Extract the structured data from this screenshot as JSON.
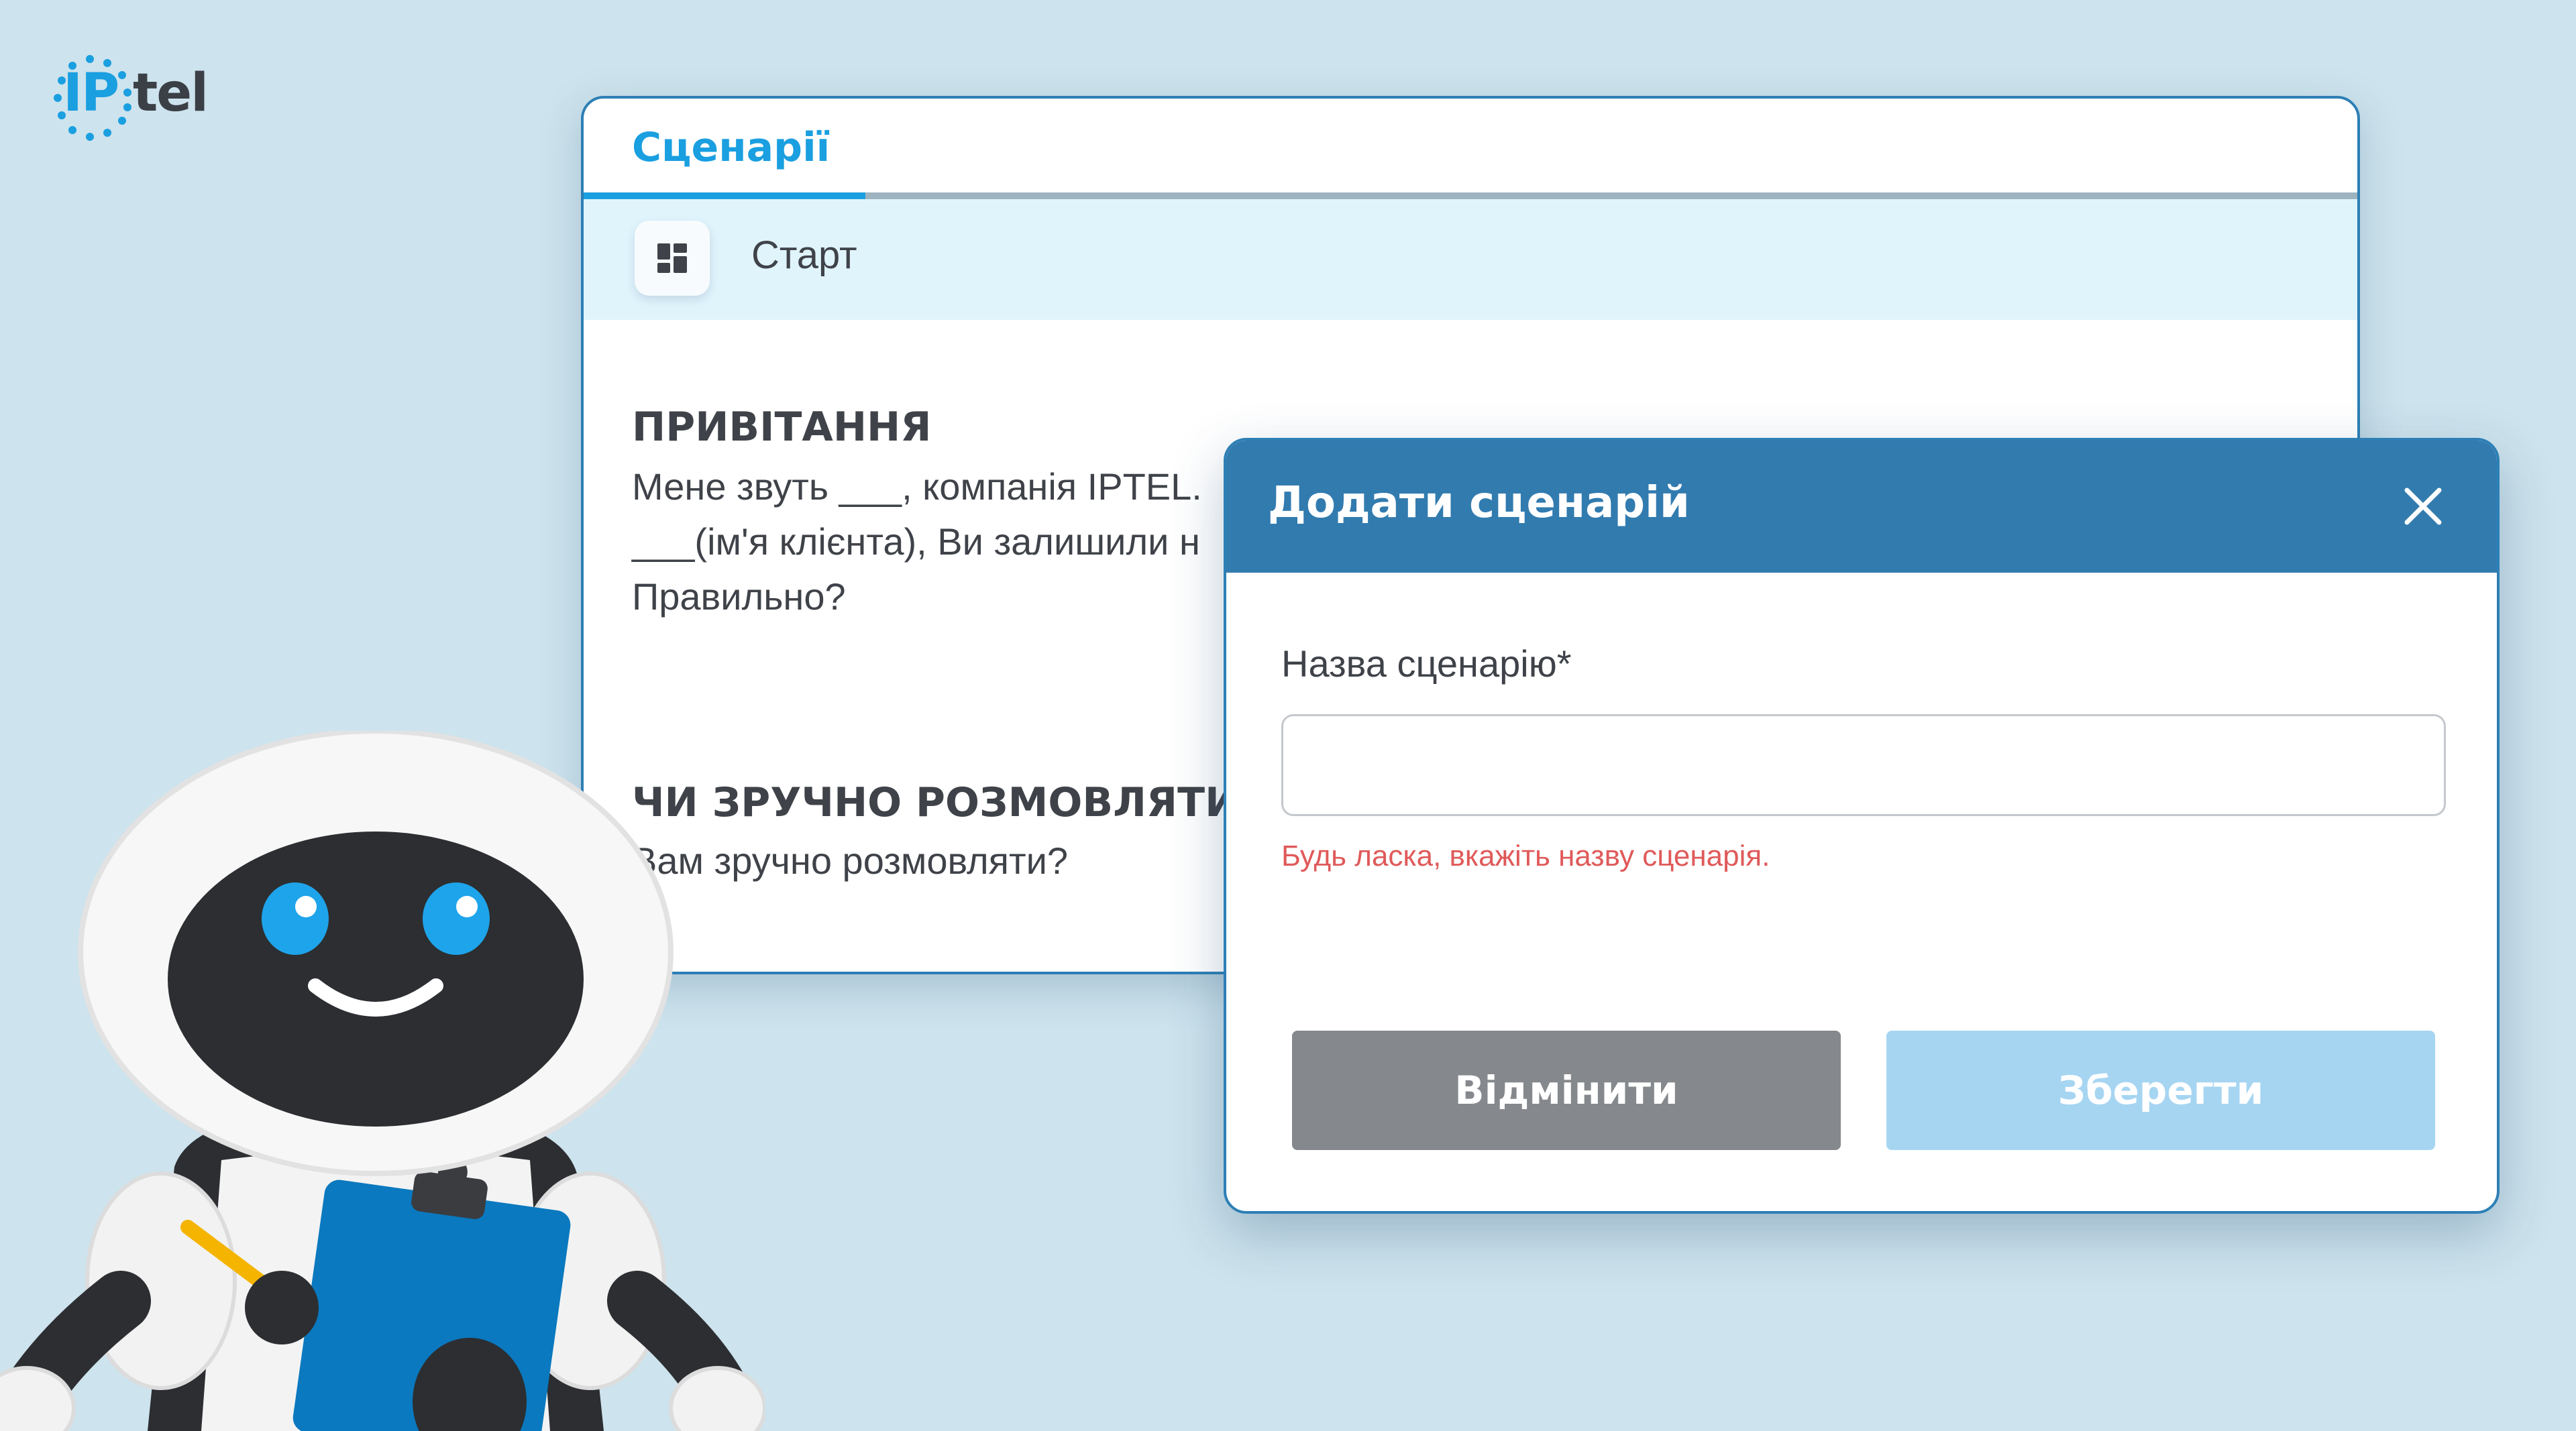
{
  "logo": {
    "ip": "IP",
    "tel": "tel",
    "brand_color": "#1a9fe0"
  },
  "card": {
    "tab_label": "Сценарії",
    "toolbar": {
      "icon": "dashboard-grid-icon",
      "label": "Старт"
    },
    "sections": [
      {
        "title": "ПРИВІТАННЯ",
        "lines": [
          "Мене звуть ___, компанія IPTEL.",
          "___(ім'я клієнта), Ви залишили н",
          "Правильно?"
        ]
      },
      {
        "title": "ЧИ ЗРУЧНО РОЗМОВЛЯТИ",
        "lines": [
          "Вам зручно розмовляти?"
        ]
      }
    ]
  },
  "modal": {
    "title": "Додати сценарій",
    "close_icon": "close-icon",
    "field_label": "Назва сценарію*",
    "field_value": "",
    "error": "Будь ласка, вкажіть назву сценарія.",
    "cancel_label": "Відмінити",
    "save_label": "Зберегти"
  },
  "colors": {
    "background": "#cde3ed",
    "accent": "#1a9fe0",
    "modal_header": "#327baf",
    "error": "#e05a5a",
    "cancel": "#85888c",
    "save_disabled": "#a6d5f2"
  }
}
